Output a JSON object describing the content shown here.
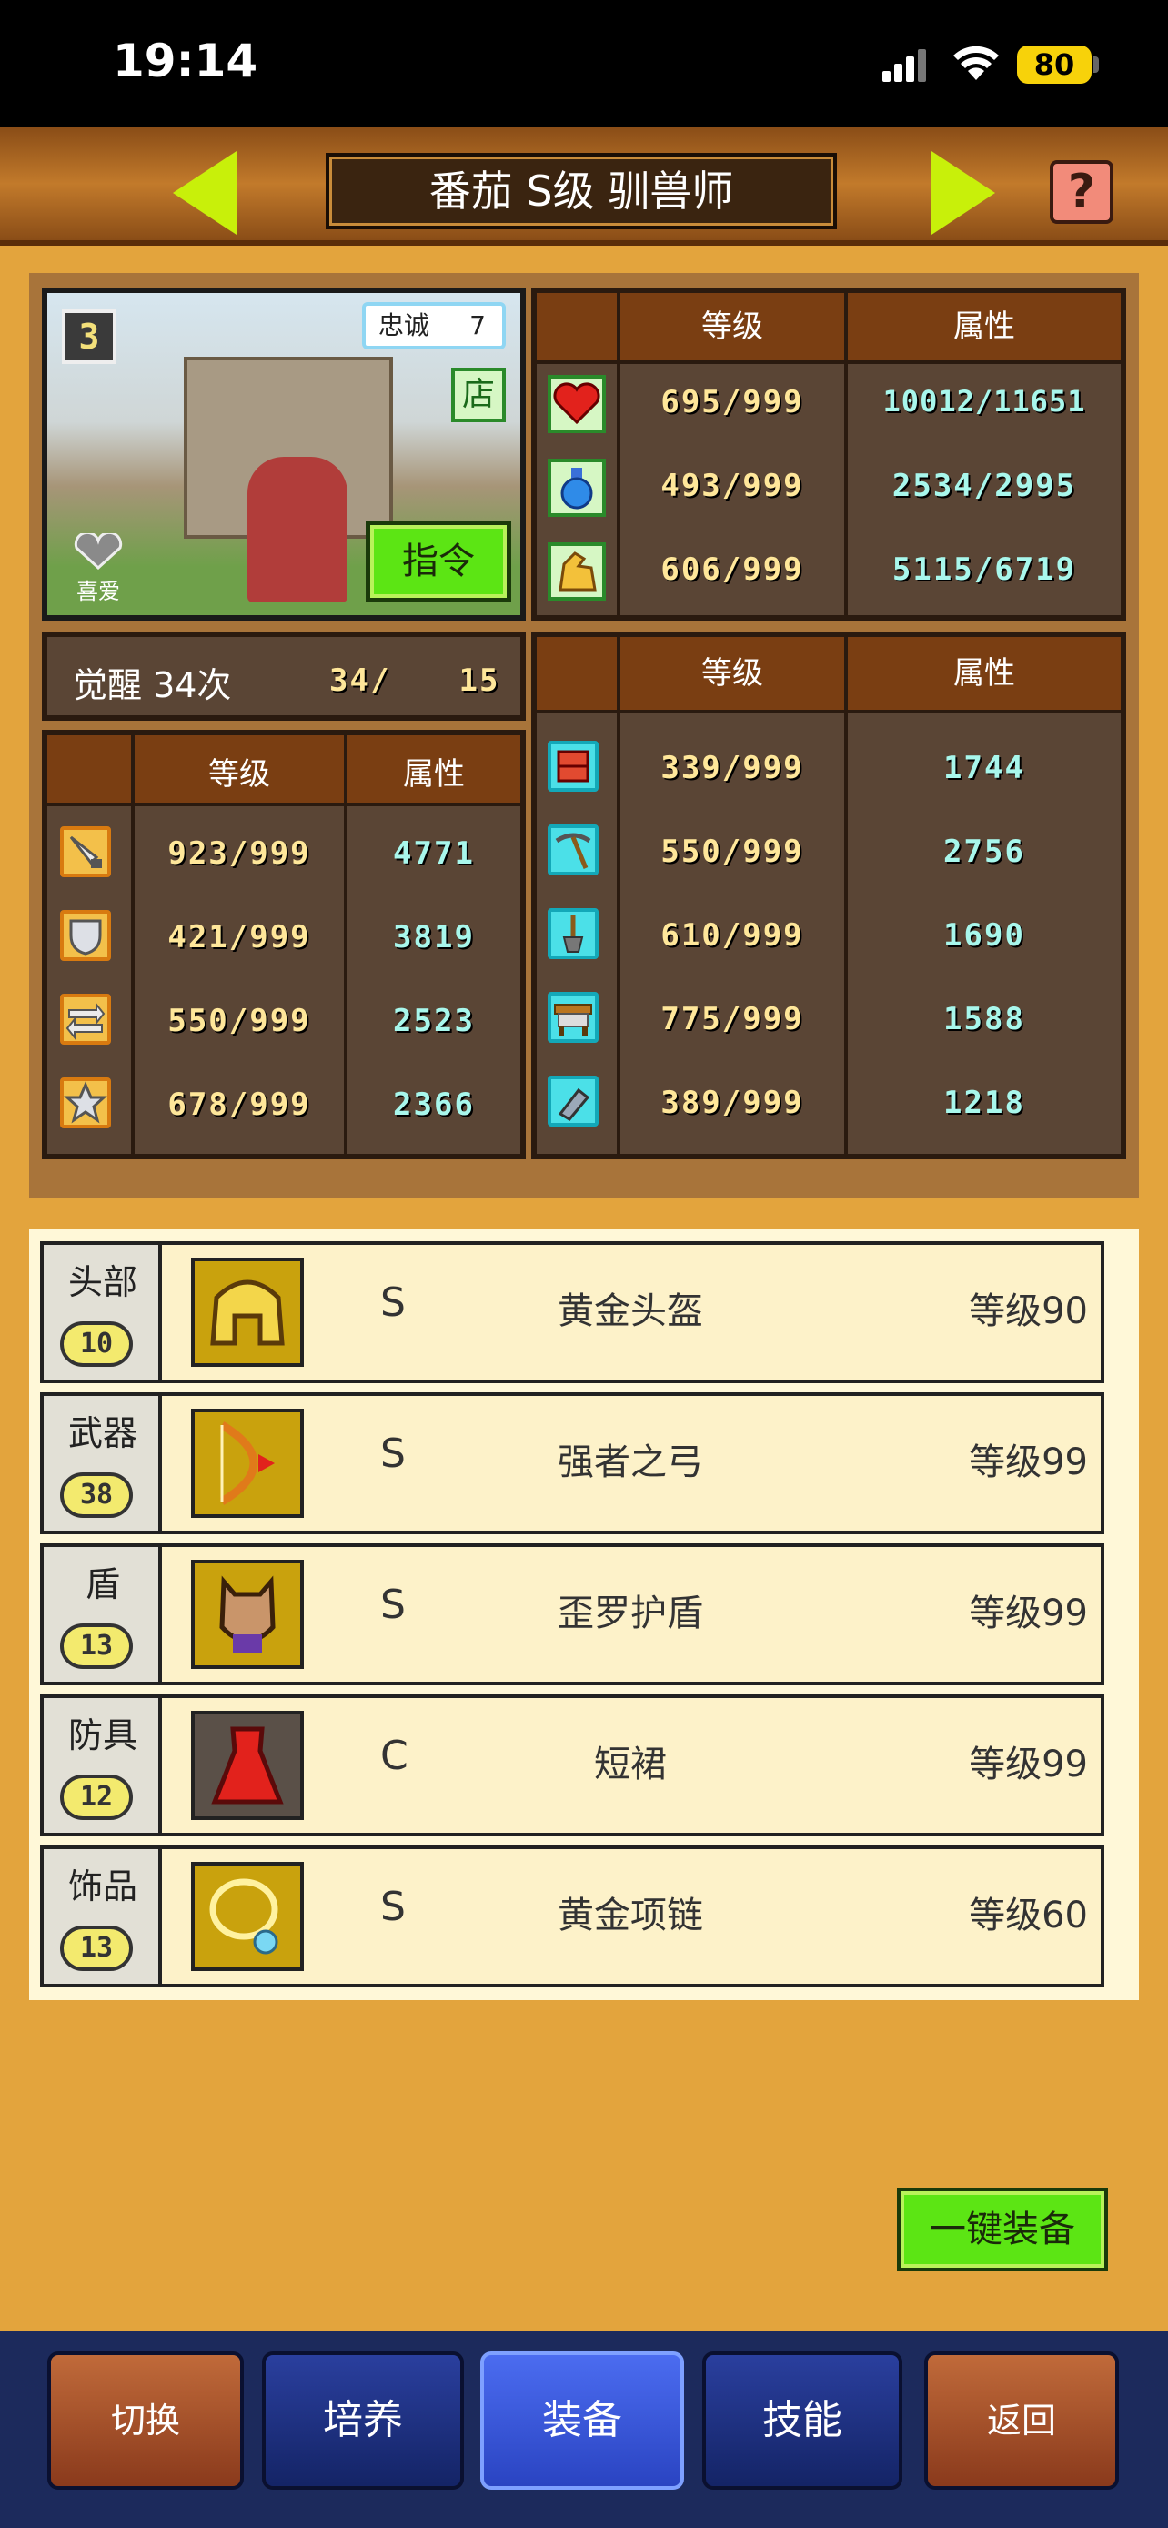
{
  "status_bar": {
    "time": "19:14",
    "battery": "80"
  },
  "header": {
    "title": "番茄 S级 驯兽师",
    "help": "?"
  },
  "portrait": {
    "rank_badge": "3",
    "loyalty_label": "忠诚",
    "loyalty_value": "7",
    "shop_label": "店",
    "favorite_label": "喜爱",
    "command_label": "指令"
  },
  "awakening": {
    "label": "觉醒 34次",
    "value": "34/",
    "max": "15"
  },
  "table_headers": {
    "level": "等级",
    "attribute": "属性"
  },
  "top_stats": [
    {
      "icon": "heart-icon",
      "level": "695/999",
      "attr": "10012/11651"
    },
    {
      "icon": "mana-potion-icon",
      "level": "493/999",
      "attr": "2534/2995"
    },
    {
      "icon": "muscle-icon",
      "level": "606/999",
      "attr": "5115/6719"
    }
  ],
  "left_stats": [
    {
      "icon": "sword-icon",
      "level": "923/999",
      "attr": "4771"
    },
    {
      "icon": "shield-icon",
      "level": "421/999",
      "attr": "3819"
    },
    {
      "icon": "speed-arrows-icon",
      "level": "550/999",
      "attr": "2523"
    },
    {
      "icon": "star-icon",
      "level": "678/999",
      "attr": "2366"
    }
  ],
  "right_stats": [
    {
      "icon": "brick-icon",
      "level": "339/999",
      "attr": "1744"
    },
    {
      "icon": "pickaxe-icon",
      "level": "550/999",
      "attr": "2756"
    },
    {
      "icon": "shovel-icon",
      "level": "610/999",
      "attr": "1690"
    },
    {
      "icon": "table-icon",
      "level": "775/999",
      "attr": "1588"
    },
    {
      "icon": "tool-icon",
      "level": "389/999",
      "attr": "1218"
    }
  ],
  "equipment": [
    {
      "slot": "头部",
      "slot_level": "10",
      "rank": "S",
      "name": "黄金头盔",
      "level": "等级90",
      "icon": "golden-helmet-icon"
    },
    {
      "slot": "武器",
      "slot_level": "38",
      "rank": "S",
      "name": "强者之弓",
      "level": "等级99",
      "icon": "bow-icon"
    },
    {
      "slot": "盾",
      "slot_level": "13",
      "rank": "S",
      "name": "歪罗护盾",
      "level": "等级99",
      "icon": "cat-shield-icon"
    },
    {
      "slot": "防具",
      "slot_level": "12",
      "rank": "C",
      "name": "短裙",
      "level": "等级99",
      "icon": "red-skirt-icon"
    },
    {
      "slot": "饰品",
      "slot_level": "13",
      "rank": "S",
      "name": "黄金项链",
      "level": "等级60",
      "icon": "gold-necklace-icon"
    }
  ],
  "equip_all_label": "一键装备",
  "nav": {
    "switch": "切换",
    "train": "培养",
    "equip": "装备",
    "skill": "技能",
    "back": "返回"
  }
}
